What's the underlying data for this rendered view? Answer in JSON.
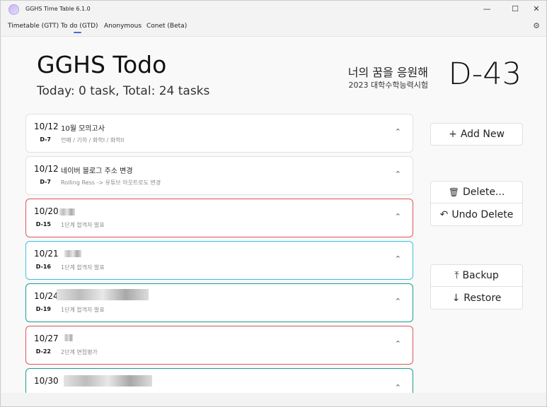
{
  "window": {
    "title": "GGHS Time Table 6.1.0",
    "minimize": "—",
    "maximize": "☐",
    "close": "✕"
  },
  "menu": {
    "items": [
      "Timetable (GTT)",
      "To do (GTD)",
      "Anonymous",
      "Conet (Beta)"
    ],
    "active_index": 1,
    "settings_icon": "⚙"
  },
  "header": {
    "title": "GGHS Todo",
    "subtitle": "Today: 0 task, Total: 24 tasks",
    "motto": "너의 꿈을 응원해",
    "exam": "2023 대학수학능력시험",
    "dday": "D-43"
  },
  "tasks": [
    {
      "date": "10/12",
      "title": "10월 모의고사",
      "dday": "D-7",
      "desc": "언매 / 기하 / 화학I / 화학II",
      "border": "none"
    },
    {
      "date": "10/12",
      "title": "네이버 블로그 주소 변경",
      "dday": "D-7",
      "desc": "Rolling Ress -> 유튜브 아웃트로도 변경",
      "border": "none"
    },
    {
      "date": "10/20",
      "title": "",
      "dday": "D-15",
      "desc": "1단계 합격자 발표",
      "border": "#e05555"
    },
    {
      "date": "10/21",
      "title": "",
      "dday": "D-16",
      "desc": "1단계 합격자 발표",
      "border": "#3ec0e0"
    },
    {
      "date": "10/24",
      "title": "",
      "dday": "D-19",
      "desc": "1단계 합격자 발표",
      "border": "#1a9e8f"
    },
    {
      "date": "10/27",
      "title": "",
      "dday": "D-22",
      "desc": "2단계 면접평가",
      "border": "#e05555"
    },
    {
      "date": "10/30",
      "title": "",
      "dday": "",
      "desc": "",
      "border": "#1a9e8f"
    }
  ],
  "actions": {
    "add": {
      "icon": "+",
      "label": "Add New"
    },
    "delete": {
      "icon": "🗑",
      "label": "Delete..."
    },
    "undo": {
      "icon": "↶",
      "label": "Undo Delete"
    },
    "backup": {
      "icon": "⤒",
      "label": "Backup"
    },
    "restore": {
      "icon": "↓",
      "label": "Restore"
    }
  },
  "chevron": "⌃"
}
